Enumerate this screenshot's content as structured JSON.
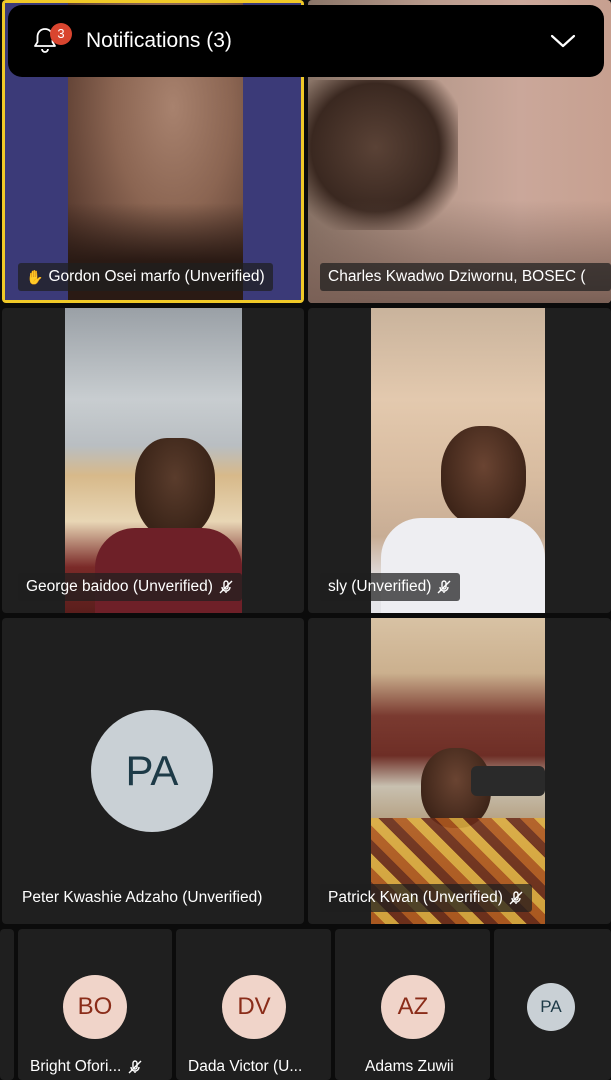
{
  "notifications": {
    "label": "Notifications (3)",
    "count": "3"
  },
  "participants": [
    {
      "name": "Gordon Osei marfo  (Unverified)",
      "hand_raised": true,
      "active_speaker": true
    },
    {
      "name": "Charles Kwadwo Dziwornu,  BOSEC ("
    },
    {
      "name": "George baidoo (Unverified)",
      "muted": true
    },
    {
      "name": "sly (Unverified)",
      "muted": true
    },
    {
      "name": "Peter Kwashie Adzaho  (Unverified)",
      "initials": "PA"
    },
    {
      "name": "Patrick Kwan  (Unverified)",
      "muted": true
    }
  ],
  "strip": [
    {
      "initials": "BO",
      "name": "Bright Ofori...",
      "muted": true
    },
    {
      "initials": "DV",
      "name": "Dada Victor  (U..."
    },
    {
      "initials": "AZ",
      "name": "Adams Zuwii"
    },
    {
      "initials": "PA",
      "name": ""
    }
  ],
  "colors": {
    "active_border": "#f0c928",
    "avatar_grey": "#c9d0d5",
    "avatar_pink": "#f0d4c9",
    "avatar_text_dark": "#1d3a47",
    "avatar_text_red": "#8a2c19",
    "badge": "#d9452f"
  }
}
